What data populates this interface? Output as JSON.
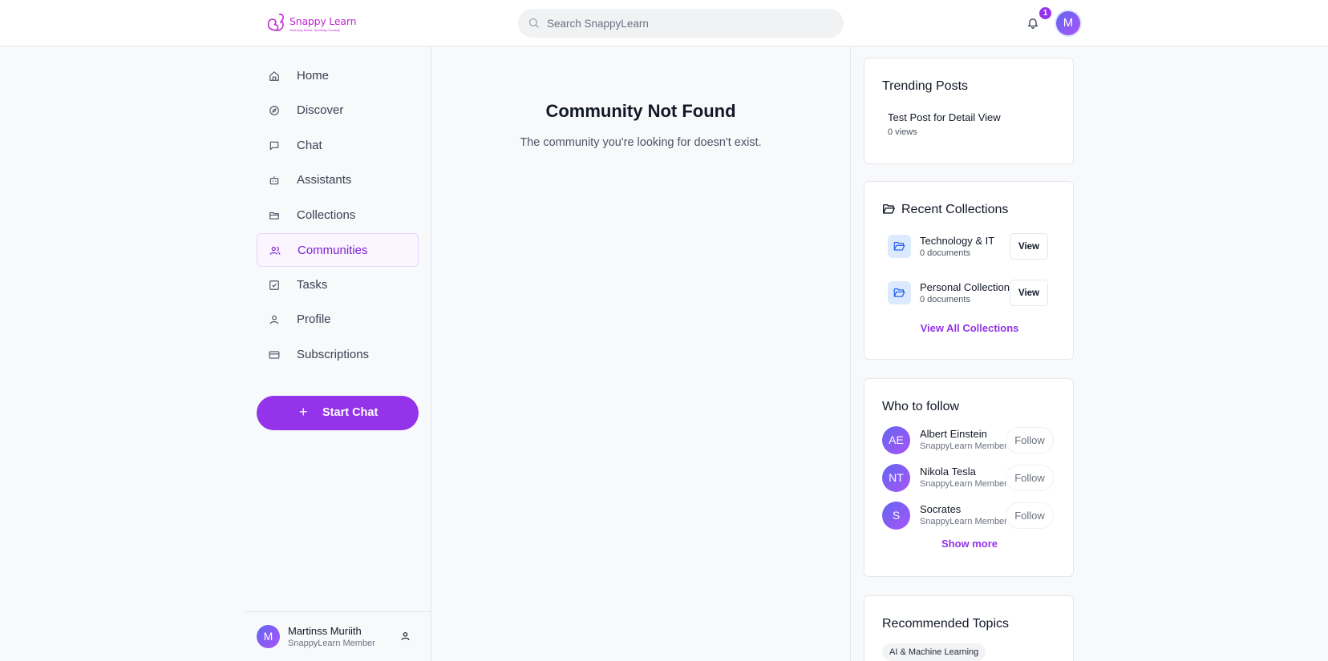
{
  "brand": {
    "logo_text": "Snappy Learn",
    "logo_tagline": "Nurturing Minds, Sparking Curiosity",
    "accent_color": "#9333ea"
  },
  "header": {
    "search_placeholder": "Search SnappyLearn",
    "notification_count": "1",
    "avatar_initial": "M"
  },
  "sidebar": {
    "items": [
      {
        "label": "Home",
        "icon": "home-icon"
      },
      {
        "label": "Discover",
        "icon": "compass-icon"
      },
      {
        "label": "Chat",
        "icon": "chat-icon"
      },
      {
        "label": "Assistants",
        "icon": "bot-icon"
      },
      {
        "label": "Collections",
        "icon": "folder-icon"
      },
      {
        "label": "Communities",
        "icon": "users-icon",
        "active": true
      },
      {
        "label": "Tasks",
        "icon": "checkbox-icon"
      },
      {
        "label": "Profile",
        "icon": "user-icon"
      },
      {
        "label": "Subscriptions",
        "icon": "credit-card-icon"
      }
    ],
    "start_chat_label": "Start Chat",
    "user": {
      "initial": "M",
      "name": "Martinss Muriith",
      "role": "SnappyLearn Member"
    }
  },
  "main": {
    "title": "Community Not Found",
    "message": "The community you're looking for doesn't exist."
  },
  "right": {
    "trending": {
      "title": "Trending Posts",
      "posts": [
        {
          "title": "Test Post for Detail View",
          "views": "0 views"
        }
      ]
    },
    "collections": {
      "title": "Recent Collections",
      "items": [
        {
          "name": "Technology & IT",
          "docs": "0 documents",
          "button": "View"
        },
        {
          "name": "Personal Collection",
          "docs": "0 documents",
          "button": "View"
        }
      ],
      "view_all": "View All Collections"
    },
    "who_to_follow": {
      "title": "Who to follow",
      "people": [
        {
          "initials": "AE",
          "name": "Albert Einstein",
          "role": "SnappyLearn Member",
          "button": "Follow"
        },
        {
          "initials": "NT",
          "name": "Nikola Tesla",
          "role": "SnappyLearn Member",
          "button": "Follow"
        },
        {
          "initials": "S",
          "name": "Socrates",
          "role": "SnappyLearn Member",
          "button": "Follow"
        }
      ],
      "show_more": "Show more"
    },
    "topics": {
      "title": "Recommended Topics",
      "items": [
        "AI & Machine Learning"
      ]
    }
  }
}
